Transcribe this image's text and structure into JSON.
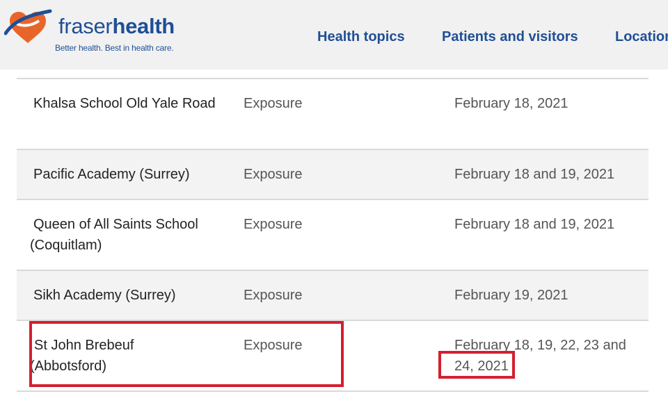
{
  "brand": {
    "name_light": "fraser",
    "name_bold": "health",
    "tagline": "Better health. Best in health care.",
    "colors": {
      "primary": "#1f4f96",
      "heart": "#e8652a",
      "heart_dark": "#c7461a"
    }
  },
  "nav": [
    {
      "label": "Health topics"
    },
    {
      "label": "Patients and visitors"
    },
    {
      "label": "Locations"
    }
  ],
  "table": {
    "rows": [
      {
        "school": "Khalsa School Old Yale Road",
        "type": "Exposure",
        "dates": "February 18, 2021"
      },
      {
        "school": "Pacific Academy (Surrey)",
        "type": "Exposure",
        "dates": "February 18 and 19, 2021"
      },
      {
        "school": "Queen of All Saints School (Coquitlam)",
        "type": "Exposure",
        "dates": "February 18 and 19, 2021"
      },
      {
        "school": "Sikh Academy (Surrey)",
        "type": "Exposure",
        "dates": "February 19, 2021"
      },
      {
        "school": "St John Brebeuf (Abbotsford)",
        "type": "Exposure",
        "dates": "February 18, 19, 22, 23 and 24, 2021"
      }
    ]
  },
  "annotations": {
    "highlight_color": "#d41f30"
  }
}
